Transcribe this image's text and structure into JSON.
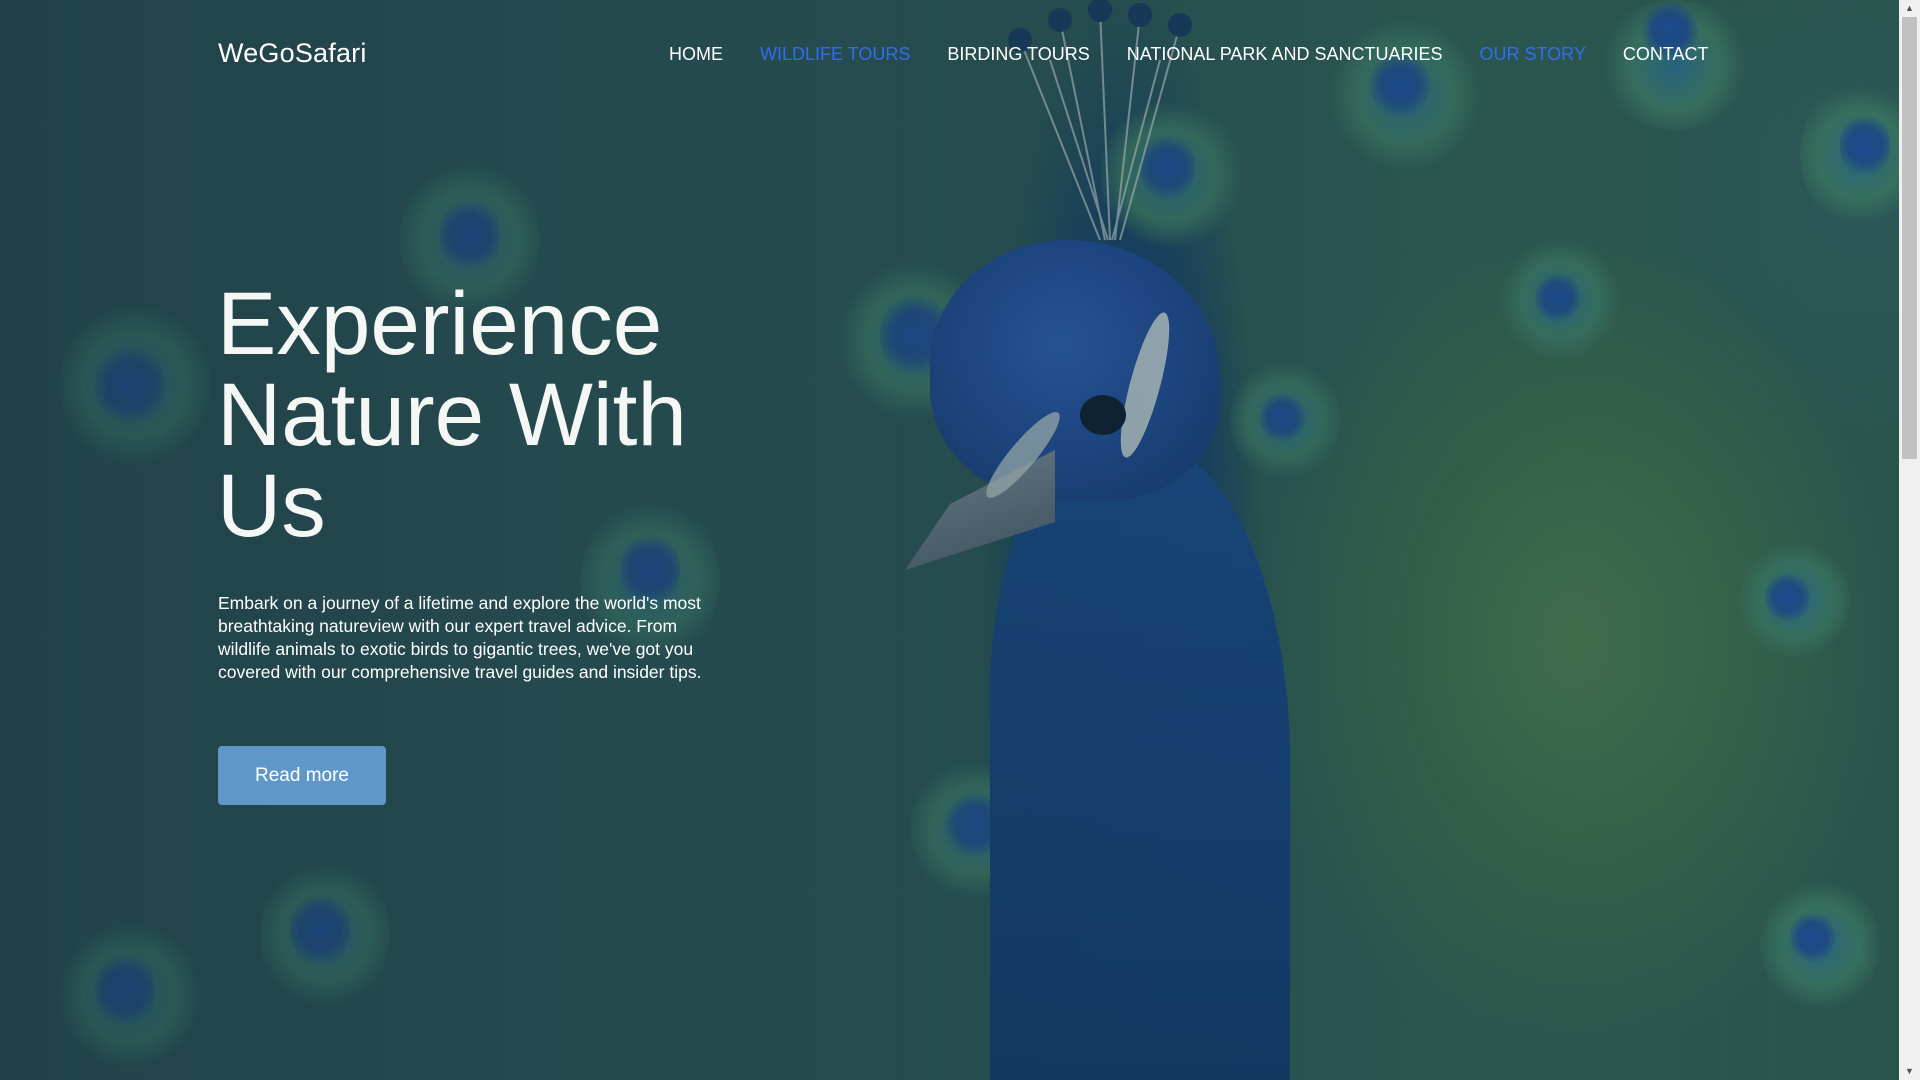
{
  "header": {
    "brand": "WeGoSafari",
    "nav": [
      {
        "label": "HOME",
        "active": false
      },
      {
        "label": "WILDLIFE TOURS",
        "active": true
      },
      {
        "label": "BIRDING TOURS",
        "active": false
      },
      {
        "label": "NATIONAL PARK AND SANCTUARIES",
        "active": false
      },
      {
        "label": "OUR STORY",
        "active": true
      },
      {
        "label": "CONTACT",
        "active": false
      }
    ],
    "active_color": "#2f6ef0"
  },
  "hero": {
    "headline": "Experience Nature With Us",
    "description": "Embark on a journey of a lifetime and explore the world's most breathtaking natureview with our expert travel advice. From wildlife animals to exotic birds to gigantic trees, we've got you covered with our comprehensive travel guides and insider tips.",
    "cta_label": "Read more",
    "cta_color": "#5f97c9",
    "background_image": "peacock-photo"
  },
  "scrollbar": {
    "up_icon": "triangle-up-icon",
    "down_icon": "triangle-down-icon"
  }
}
